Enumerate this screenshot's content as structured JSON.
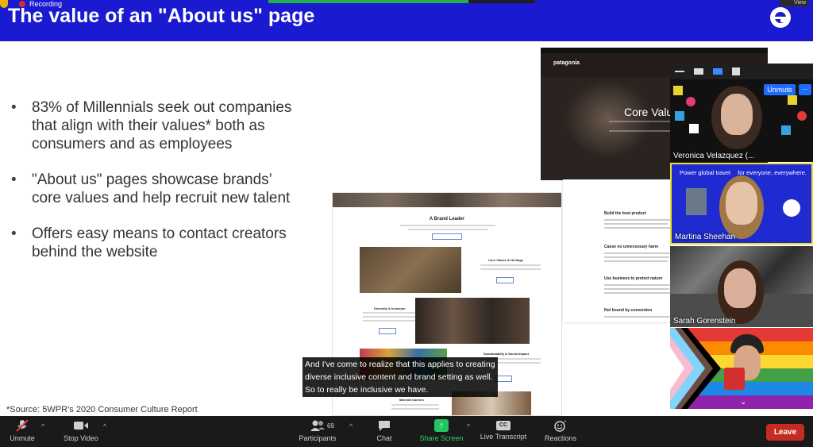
{
  "slide": {
    "title": "The value of an \"About us\"  page",
    "bullets": [
      "83% of Millennials seek out companies that align with their values* both as consumers and as employees",
      "\"About us\" pages showcase brands’ core values and help recruit new talent",
      "Offers easy means to contact creators behind the website"
    ],
    "source": "*Source: 5WPR’s 2020 Consumer Culture Report"
  },
  "topbar": {
    "recording_label": "Recording",
    "view_label": "View",
    "share_progress": 0.75
  },
  "patagonia": {
    "logo": "patagonia",
    "heading": "Core Valu"
  },
  "marriott": {
    "section_title": "A Brand Leader",
    "core_values": "Core Values & Heritage",
    "diversity": "Diversity & Inclusion",
    "sustainability": "Sustainability & Social Impact",
    "careers": "Marriott Careers"
  },
  "article": {
    "headings": [
      "Build the best product",
      "Cause no unnecessary harm",
      "Use business to protect nature",
      "Not bound by convention"
    ]
  },
  "captions": {
    "text": "And I've come to realize that this applies to creating diverse inclusive content and brand setting as well. So to really be inclusive we have."
  },
  "participants": [
    {
      "name": "Veronica Velazquez (..."
    },
    {
      "name": "Martina Sheehan",
      "overlay_left": "Power global travel",
      "overlay_right": "for everyone, everywhere."
    },
    {
      "name": "Sarah Gorenstein"
    },
    {
      "name": ""
    }
  ],
  "tile_controls": {
    "unmute": "Unmute",
    "more": "···"
  },
  "toolbar": {
    "unmute": "Unmute",
    "stop_video": "Stop Video",
    "participants": "Participants",
    "participant_count": "69",
    "chat": "Chat",
    "share_screen": "Share Screen",
    "live_transcript": "Live Transcript",
    "reactions": "Reactions",
    "leave": "Leave"
  },
  "colors": {
    "slide_header": "#1a1ad1",
    "leave": "#c42c22",
    "share_green": "#23c55e",
    "active_speaker_border": "#e8e030"
  }
}
